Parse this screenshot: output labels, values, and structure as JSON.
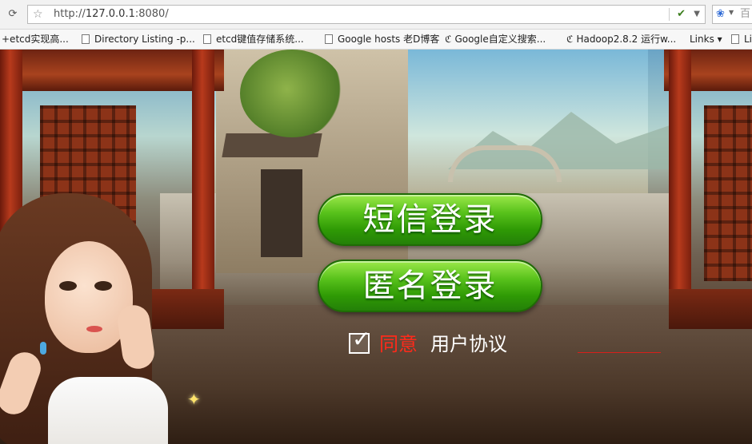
{
  "browser": {
    "url_prefix": "http://",
    "url_host": "127.0.0.1",
    "url_suffix": ":8080/",
    "search_placeholder": "百",
    "icons": {
      "reload": "reload-icon",
      "bookmark_star": "star-icon",
      "plugin": "plugin-icon",
      "search_engine": "baidu-paw-icon"
    }
  },
  "bookmarks": [
    {
      "label": "+etcd实现高...",
      "icon": "none"
    },
    {
      "label": "Directory Listing -p...",
      "icon": "page-icon"
    },
    {
      "label": "etcd键值存储系统...",
      "icon": "page-icon"
    },
    {
      "label": "Google hosts 老D博客",
      "icon": "page-icon"
    },
    {
      "label": "Google自定义搜索...",
      "icon": "link-icon"
    },
    {
      "label": "Hadoop2.8.2 运行w...",
      "icon": "link-icon"
    },
    {
      "label": "Links ▾",
      "icon": "none"
    },
    {
      "label": "Li",
      "icon": "page-icon"
    }
  ],
  "game": {
    "sms_login_label": "短信登录",
    "anon_login_label": "匿名登录",
    "agree_label": "同意",
    "agreement_link": "用户协议",
    "agree_checked": true,
    "colors": {
      "button_green": "#3fae0e",
      "agree_red": "#ff2a1a",
      "text_white": "#ffffff"
    }
  }
}
